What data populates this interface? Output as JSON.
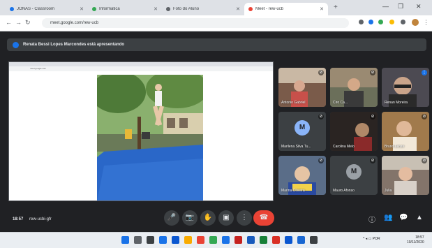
{
  "browser": {
    "tabs": [
      {
        "title": "JONAS - Classroom",
        "color": "#1a73e8",
        "active": false
      },
      {
        "title": "Informática",
        "color": "#34a853",
        "active": false
      },
      {
        "title": "Foto do Aluno",
        "color": "#5f6368",
        "active": false
      },
      {
        "title": "Meet - rew-ucb",
        "color": "#ea4335",
        "active": true
      }
    ],
    "url": "meet.google.com/rew-ucb",
    "window_controls": [
      "—",
      "❐",
      "✕"
    ]
  },
  "banner": {
    "text": "Renata Bessi Lopes Marcondes está apresentando"
  },
  "presentation": {
    "mini_url": "meet.google.com"
  },
  "participants": [
    {
      "name": "Antonio Gabriel",
      "mic": "off",
      "kind": "video",
      "bg": "#7a5b4a"
    },
    {
      "name": "Ciro Ca...",
      "mic": "off",
      "kind": "video",
      "bg": "#6b6f5a"
    },
    {
      "name": "Renan Moreira",
      "mic": "on",
      "kind": "video",
      "bg": "#4c4a52"
    },
    {
      "name": "Marilena Silva Tu...",
      "mic": "off",
      "kind": "avatar",
      "initial": "M",
      "bg": "#3c4043"
    },
    {
      "name": "Carolina Melo",
      "mic": "off",
      "kind": "video",
      "bg": "#2a2422"
    },
    {
      "name": "Bruno Lenze",
      "mic": "off",
      "kind": "video",
      "bg": "#a17a4c"
    },
    {
      "name": "Marina Oliveira",
      "mic": "off",
      "kind": "video",
      "bg": "#5a6d88"
    },
    {
      "name": "Mauro Afonso",
      "mic": "off",
      "kind": "avatar",
      "initial": "M",
      "bg": "#3c4043"
    },
    {
      "name": "Julia",
      "mic": "off",
      "kind": "video",
      "bg": "#83746a"
    }
  ],
  "bottom_bar": {
    "time": "18:57",
    "meeting_code": "rew-ucbi-gfr"
  },
  "controls": [
    {
      "name": "mic",
      "icon": "🎤"
    },
    {
      "name": "camera",
      "icon": "📷"
    },
    {
      "name": "raise-hand",
      "icon": "✋"
    },
    {
      "name": "present",
      "icon": "▣"
    },
    {
      "name": "more",
      "icon": "⋮"
    },
    {
      "name": "end-call",
      "icon": "☎"
    }
  ],
  "right_controls": [
    {
      "name": "info",
      "icon": "ⓘ"
    },
    {
      "name": "people",
      "icon": "👥"
    },
    {
      "name": "chat",
      "icon": "💬"
    },
    {
      "name": "activities",
      "icon": "▲"
    }
  ],
  "taskbar": {
    "tray": "^  ◂  ▭  POR",
    "time": "18:57",
    "date": "10/11/2020"
  }
}
